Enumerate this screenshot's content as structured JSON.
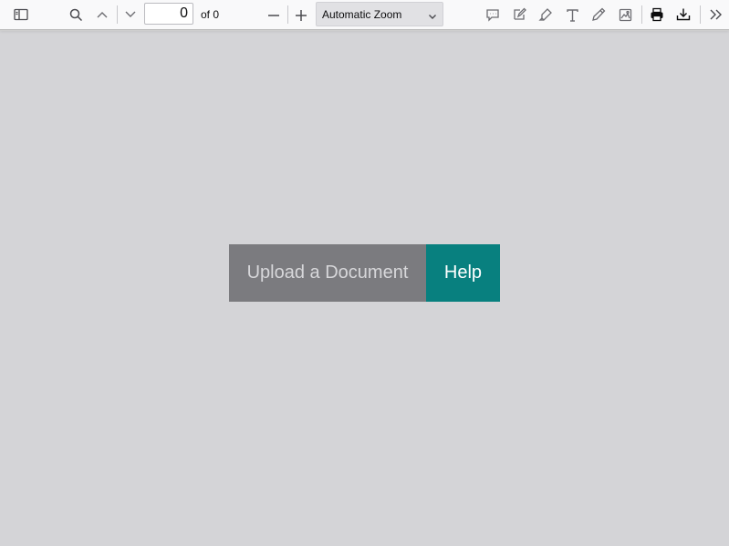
{
  "toolbar": {
    "sidebar_toggle_icon": "sidebar-toggle-icon",
    "find_icon": "search-icon",
    "previous_icon": "chevron-up-icon",
    "next_icon": "chevron-down-icon",
    "page_number": "0",
    "page_count_label": "of 0",
    "zoom_out_icon": "minus-icon",
    "zoom_in_icon": "plus-icon",
    "zoom_value": "Automatic Zoom",
    "comment_icon": "comment-icon",
    "edit_icon": "edit-icon",
    "highlight_icon": "highlight-icon",
    "text_icon": "text-icon",
    "draw_icon": "draw-icon",
    "image_icon": "image-icon",
    "print_icon": "print-icon",
    "download_icon": "download-icon",
    "tools_icon": "double-chevron-right-icon"
  },
  "main": {
    "upload_label": "Upload a Document",
    "help_label": "Help"
  },
  "colors": {
    "background": "#d4d4d7",
    "toolbar": "#f9f9fa",
    "upload_button": "#7b7b7f",
    "help_button": "#08807f"
  }
}
